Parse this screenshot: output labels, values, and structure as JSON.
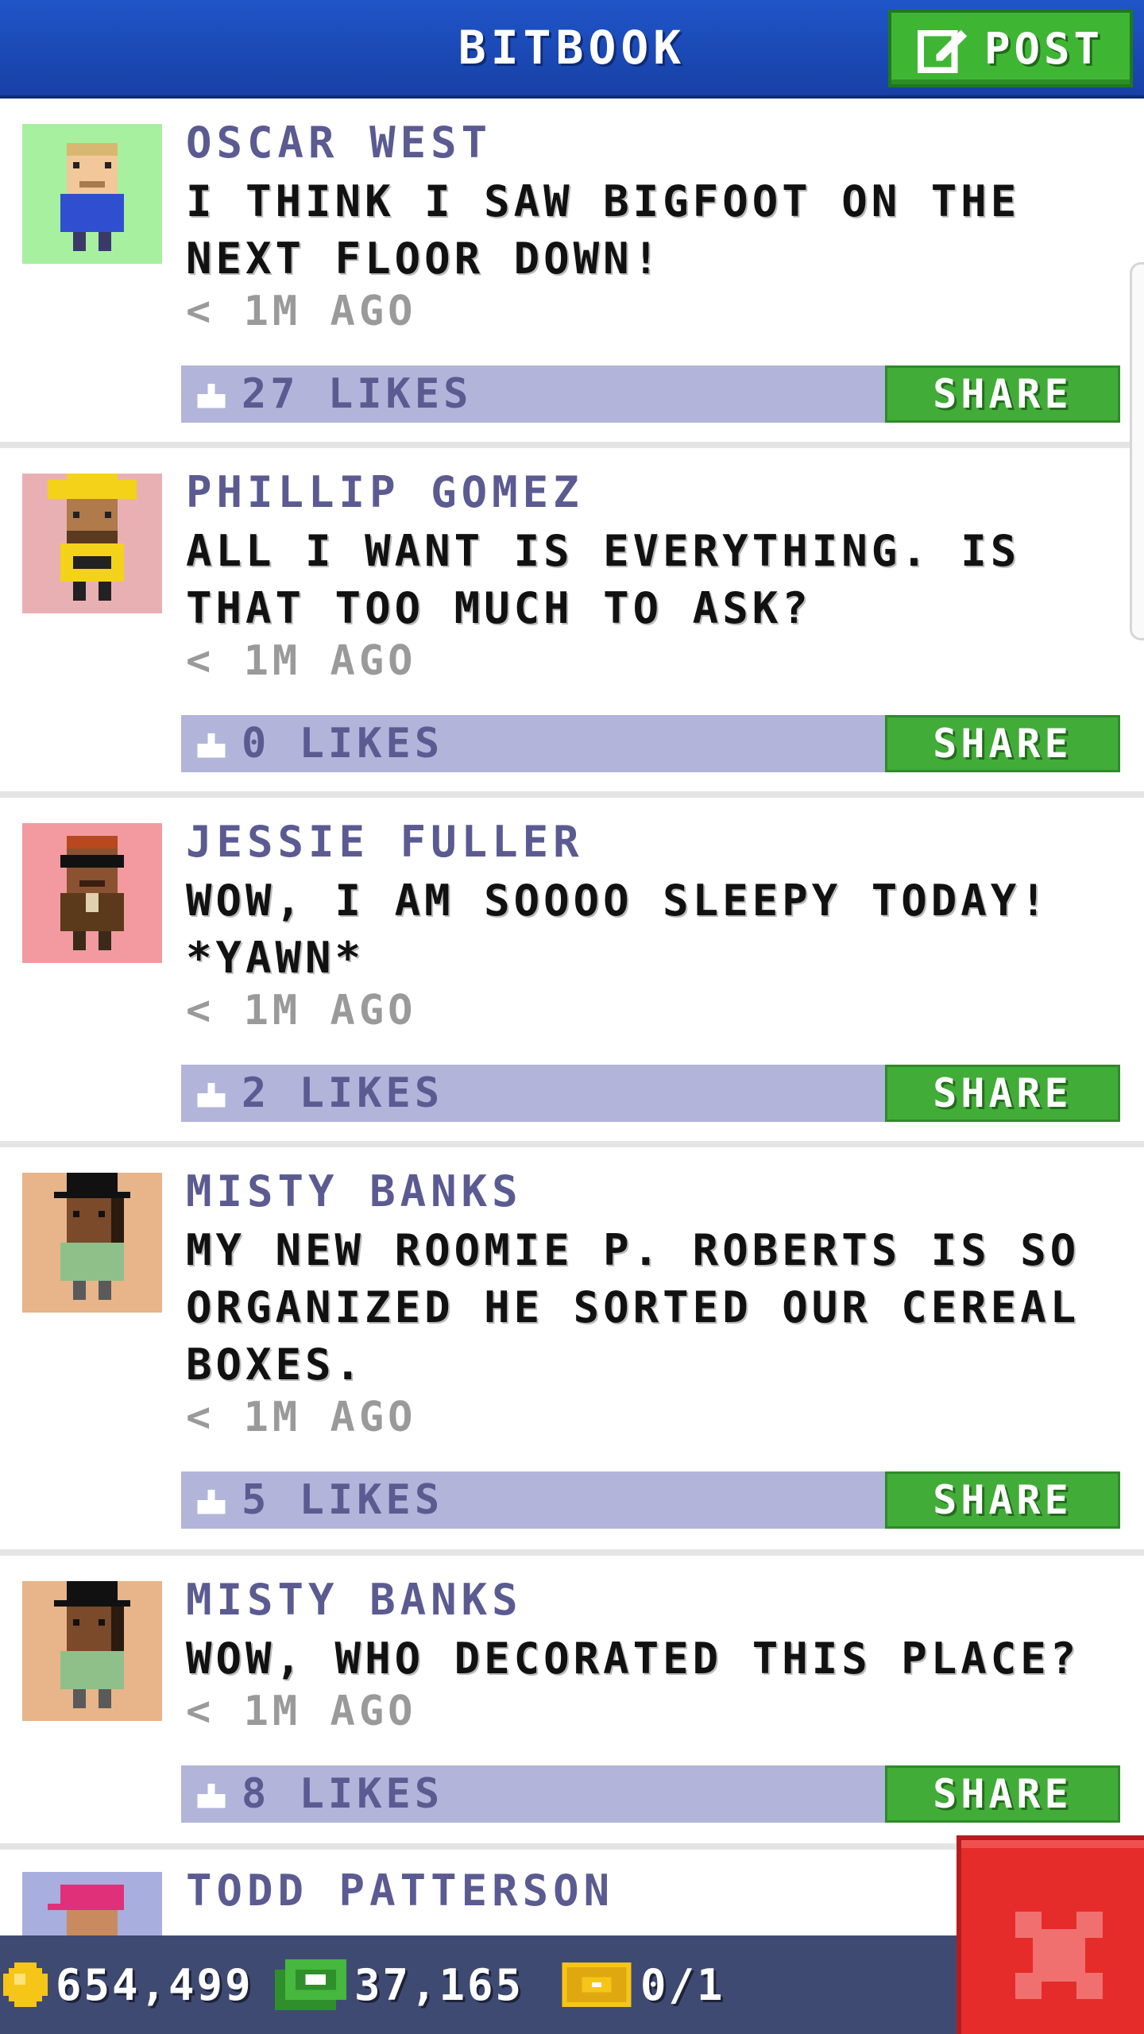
{
  "header": {
    "title": "BITBOOK",
    "post_label": "POST"
  },
  "posts": [
    {
      "author": "OSCAR WEST",
      "message": "I THINK I SAW BIGFOOT ON THE NEXT FLOOR DOWN!",
      "time": "< 1M AGO",
      "likes": "27 LIKES",
      "share": "SHARE",
      "avatar_bg": "#a7f0a0"
    },
    {
      "author": "PHILLIP GOMEZ",
      "message": "ALL I WANT IS EVERYTHING. IS THAT TOO MUCH TO ASK?",
      "time": "< 1M AGO",
      "likes": "0 LIKES",
      "share": "SHARE",
      "avatar_bg": "#e9b0b3"
    },
    {
      "author": "JESSIE FULLER",
      "message": "WOW, I AM SOOOO SLEEPY TODAY! *YAWN*",
      "time": "< 1M AGO",
      "likes": "2 LIKES",
      "share": "SHARE",
      "avatar_bg": "#f29aa0"
    },
    {
      "author": "MISTY BANKS",
      "message": "MY NEW ROOMIE P. ROBERTS IS SO ORGANIZED HE SORTED OUR CEREAL BOXES.",
      "time": "< 1M AGO",
      "likes": "5 LIKES",
      "share": "SHARE",
      "avatar_bg": "#e8b489"
    },
    {
      "author": "MISTY BANKS",
      "message": "WOW, WHO DECORATED THIS PLACE?",
      "time": "< 1M AGO",
      "likes": "8 LIKES",
      "share": "SHARE",
      "avatar_bg": "#e8b489"
    },
    {
      "author": "TODD PATTERSON",
      "avatar_bg": "#a8aede"
    }
  ],
  "bottom_bar": {
    "coins": "654,499",
    "bux": "37,165",
    "tickets": "0/1"
  },
  "colors": {
    "header": "#1f55c8",
    "share_green": "#42ac38",
    "likes_bar": "#b2b4da",
    "author_text": "#5b5b92",
    "close_red": "#e62b2b"
  }
}
